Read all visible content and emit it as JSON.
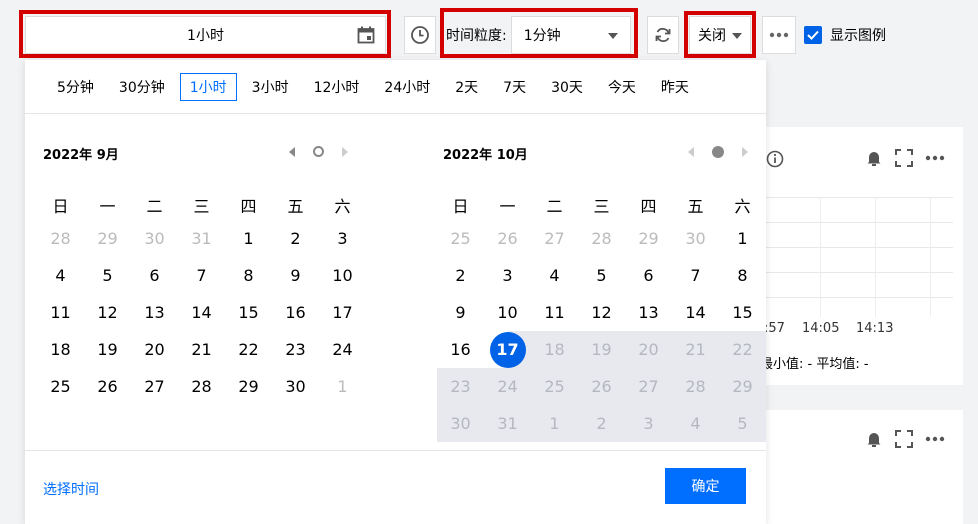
{
  "toolbar": {
    "range_value": "1小时",
    "granularity_label": "时间粒度:",
    "granularity_value": "1分钟",
    "refresh_value": "关闭",
    "show_legend_label": "显示图例",
    "show_legend_checked": true
  },
  "quick_ranges": [
    "5分钟",
    "30分钟",
    "1小时",
    "3小时",
    "12小时",
    "24小时",
    "2天",
    "7天",
    "30天",
    "今天",
    "昨天"
  ],
  "active_quick_range": "1小时",
  "weekdays": [
    "日",
    "一",
    "二",
    "三",
    "四",
    "五",
    "六"
  ],
  "calendar_left": {
    "title": "2022年 9月",
    "rows": [
      [
        {
          "d": "28",
          "s": "muted"
        },
        {
          "d": "29",
          "s": "muted"
        },
        {
          "d": "30",
          "s": "muted"
        },
        {
          "d": "31",
          "s": "muted"
        },
        {
          "d": "1"
        },
        {
          "d": "2"
        },
        {
          "d": "3"
        }
      ],
      [
        {
          "d": "4"
        },
        {
          "d": "5"
        },
        {
          "d": "6"
        },
        {
          "d": "7"
        },
        {
          "d": "8"
        },
        {
          "d": "9"
        },
        {
          "d": "10"
        }
      ],
      [
        {
          "d": "11"
        },
        {
          "d": "12"
        },
        {
          "d": "13"
        },
        {
          "d": "14"
        },
        {
          "d": "15"
        },
        {
          "d": "16"
        },
        {
          "d": "17"
        }
      ],
      [
        {
          "d": "18"
        },
        {
          "d": "19"
        },
        {
          "d": "20"
        },
        {
          "d": "21"
        },
        {
          "d": "22"
        },
        {
          "d": "23"
        },
        {
          "d": "24"
        }
      ],
      [
        {
          "d": "25"
        },
        {
          "d": "26"
        },
        {
          "d": "27"
        },
        {
          "d": "28"
        },
        {
          "d": "29"
        },
        {
          "d": "30"
        },
        {
          "d": "1",
          "s": "muted"
        }
      ]
    ]
  },
  "calendar_right": {
    "title": "2022年 10月",
    "rows": [
      [
        {
          "d": "25",
          "s": "muted"
        },
        {
          "d": "26",
          "s": "muted"
        },
        {
          "d": "27",
          "s": "muted"
        },
        {
          "d": "28",
          "s": "muted"
        },
        {
          "d": "29",
          "s": "muted"
        },
        {
          "d": "30",
          "s": "muted"
        },
        {
          "d": "1"
        }
      ],
      [
        {
          "d": "2"
        },
        {
          "d": "3"
        },
        {
          "d": "4"
        },
        {
          "d": "5"
        },
        {
          "d": "6"
        },
        {
          "d": "7"
        },
        {
          "d": "8"
        }
      ],
      [
        {
          "d": "9"
        },
        {
          "d": "10"
        },
        {
          "d": "11"
        },
        {
          "d": "12"
        },
        {
          "d": "13"
        },
        {
          "d": "14"
        },
        {
          "d": "15"
        }
      ],
      [
        {
          "d": "16"
        },
        {
          "d": "17",
          "s": "selected"
        },
        {
          "d": "18",
          "s": "range"
        },
        {
          "d": "19",
          "s": "range"
        },
        {
          "d": "20",
          "s": "range"
        },
        {
          "d": "21",
          "s": "range"
        },
        {
          "d": "22",
          "s": "range"
        }
      ],
      [
        {
          "d": "23",
          "s": "range"
        },
        {
          "d": "24",
          "s": "range"
        },
        {
          "d": "25",
          "s": "range"
        },
        {
          "d": "26",
          "s": "range"
        },
        {
          "d": "27",
          "s": "range"
        },
        {
          "d": "28",
          "s": "range"
        },
        {
          "d": "29",
          "s": "range"
        }
      ],
      [
        {
          "d": "30",
          "s": "range"
        },
        {
          "d": "31",
          "s": "range"
        },
        {
          "d": "1",
          "s": "range"
        },
        {
          "d": "2",
          "s": "range"
        },
        {
          "d": "3",
          "s": "range"
        },
        {
          "d": "4",
          "s": "range"
        },
        {
          "d": "5",
          "s": "range"
        }
      ]
    ]
  },
  "footer": {
    "select_time_label": "选择时间",
    "confirm_label": "确定"
  },
  "bg_panel": {
    "time_ticks": [
      ":57",
      "14:05",
      "14:13"
    ],
    "stats_text": "最小值: -  平均值: -"
  },
  "colors": {
    "accent": "#006eff",
    "highlight_frame": "#d40000",
    "range_bg": "#e7e9ee"
  }
}
